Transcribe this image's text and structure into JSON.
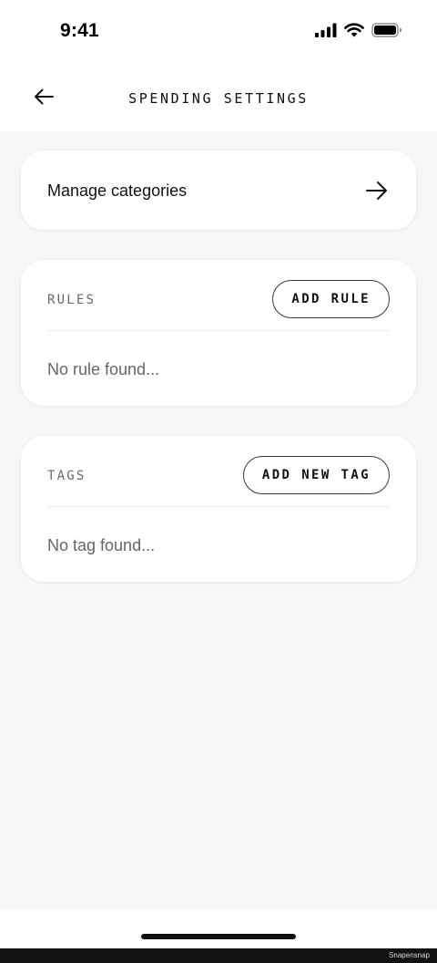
{
  "status_bar": {
    "time": "9:41",
    "icons": [
      "cellular-signal-icon",
      "wifi-icon",
      "battery-icon"
    ]
  },
  "header": {
    "title": "SPENDING SETTINGS",
    "back_icon": "arrow-left-icon"
  },
  "manage_categories": {
    "label": "Manage categories",
    "icon": "arrow-right-icon"
  },
  "rules": {
    "label": "RULES",
    "button_label": "ADD RULE",
    "empty_text": "No rule found..."
  },
  "tags": {
    "label": "TAGS",
    "button_label": "ADD NEW TAG",
    "empty_text": "No tag found..."
  },
  "footer": {
    "watermark": "Snapensnap"
  },
  "colors": {
    "background": "#f7f7f5",
    "card": "#ffffff",
    "text_primary": "#111111",
    "text_muted": "#666666"
  }
}
